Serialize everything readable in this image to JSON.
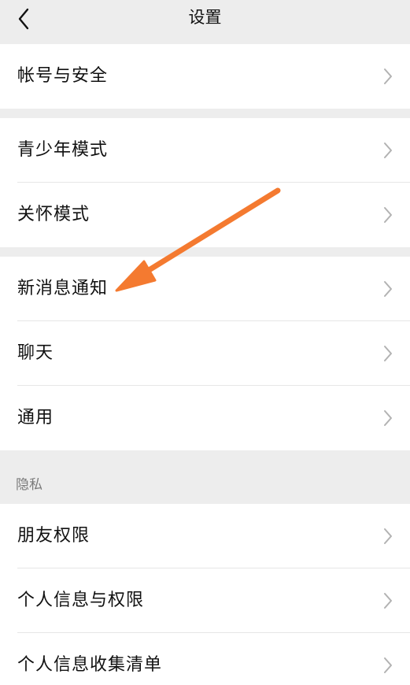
{
  "header": {
    "title": "设置"
  },
  "groups": [
    {
      "items": [
        {
          "label": "帐号与安全"
        }
      ]
    },
    {
      "items": [
        {
          "label": "青少年模式"
        },
        {
          "label": "关怀模式"
        }
      ]
    },
    {
      "items": [
        {
          "label": "新消息通知"
        },
        {
          "label": "聊天"
        },
        {
          "label": "通用"
        }
      ]
    },
    {
      "section_label": "隐私",
      "items": [
        {
          "label": "朋友权限"
        },
        {
          "label": "个人信息与权限"
        },
        {
          "label": "个人信息收集清单"
        }
      ]
    }
  ],
  "annotation": {
    "arrow_color": "#f47a30",
    "target": "新消息通知"
  },
  "colors": {
    "page_bg": "#ededed",
    "cell_bg": "#ffffff",
    "chevron": "#b2b2b2"
  }
}
